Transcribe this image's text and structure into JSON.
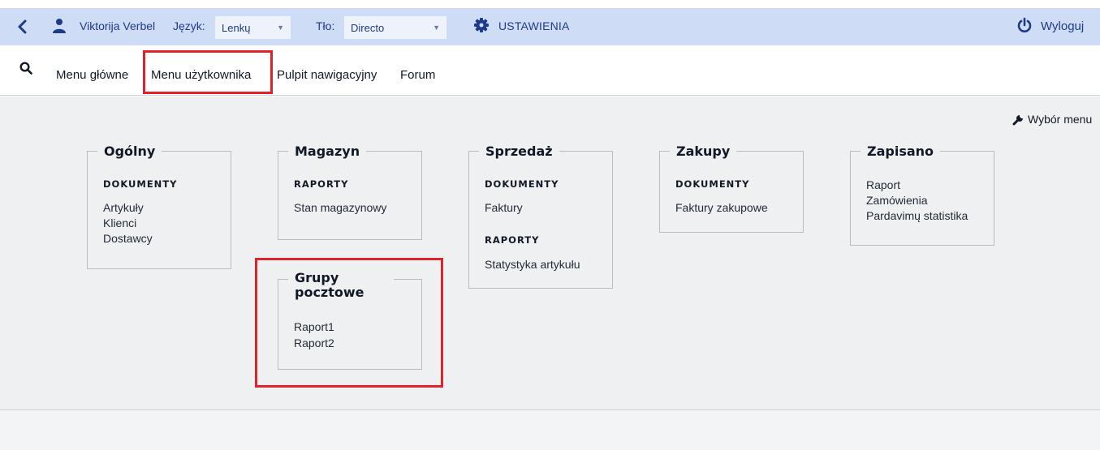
{
  "topbar": {
    "user_name": "Viktorija Verbel",
    "language_label": "Język:",
    "language_value": "Lenkų",
    "background_label": "Tło:",
    "background_value": "Directo",
    "settings_label": "USTAWIENIA",
    "logout_label": "Wyloguj",
    "background_color": "#cfdcf5"
  },
  "nav": {
    "items": [
      {
        "label": "Menu główne"
      },
      {
        "label": "Menu użytkownika"
      },
      {
        "label": "Pulpit nawigacyjny"
      },
      {
        "label": "Forum"
      }
    ]
  },
  "content": {
    "menu_choice_label": "Wybór menu",
    "cards": {
      "general": {
        "title": "Ogólny",
        "sections": [
          {
            "title": "DOKUMENTY",
            "items": [
              "Artykuły",
              "Klienci",
              "Dostawcy"
            ]
          }
        ]
      },
      "warehouse": {
        "title": "Magazyn",
        "sections": [
          {
            "title": "RAPORTY",
            "items": [
              "Stan magazynowy"
            ]
          }
        ]
      },
      "sales": {
        "title": "Sprzedaż",
        "sections": [
          {
            "title": "DOKUMENTY",
            "items": [
              "Faktury"
            ]
          },
          {
            "title": "RAPORTY",
            "items": [
              "Statystyka artykułu"
            ]
          }
        ]
      },
      "purchases": {
        "title": "Zakupy",
        "sections": [
          {
            "title": "DOKUMENTY",
            "items": [
              "Faktury zakupowe"
            ]
          }
        ]
      },
      "saved": {
        "title": "Zapisano",
        "items": [
          "Raport",
          "Zamówienia",
          "Pardavimų statistika"
        ]
      },
      "postal": {
        "title": "Grupy pocztowe",
        "items": [
          "Raport1",
          "Raport2"
        ]
      }
    }
  },
  "colors": {
    "highlight": "#e0232b",
    "link": "#1e3a8a",
    "content_bg": "#eff0f1"
  }
}
